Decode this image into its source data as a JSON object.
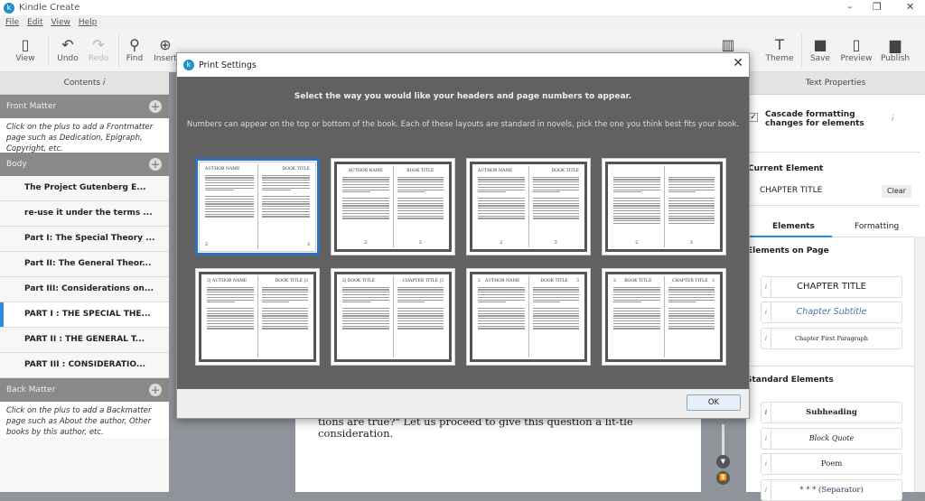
{
  "app": {
    "title": "Kindle Create",
    "window_controls": [
      "–",
      "❐",
      "✕"
    ]
  },
  "menu": [
    "File",
    "Edit",
    "View",
    "Help"
  ],
  "toolbar": {
    "left": [
      {
        "label": "View",
        "icon": "view-icon"
      },
      {
        "label": "Undo",
        "icon": "undo-icon"
      },
      {
        "label": "Redo",
        "icon": "redo-icon",
        "disabled": true
      },
      {
        "label": "Find",
        "icon": "search-icon"
      },
      {
        "label": "Insert",
        "icon": "plus-circle-icon"
      }
    ],
    "right": [
      {
        "label": "Theme",
        "icon": "theme-icon"
      },
      {
        "label": "Save",
        "icon": "save-icon"
      },
      {
        "label": "Preview",
        "icon": "tablet-icon"
      },
      {
        "label": "Publish",
        "icon": "box-icon"
      }
    ]
  },
  "contents": {
    "title": "Contents",
    "front_matter": {
      "label": "Front Matter",
      "hint": "Click on the plus to add a Frontmatter page such as Dedication, Epigraph, Copyright, etc."
    },
    "body": {
      "label": "Body",
      "items": [
        "The Project Gutenberg E...",
        "re-use it under the terms ...",
        "Part I: The Special Theory ...",
        "Part II: The General Theor...",
        "Part III: Considerations on...",
        "PART I : THE SPECIAL THE...",
        "PART II : THE GENERAL T...",
        "PART III : CONSIDERATIO..."
      ],
      "selected_index": 5
    },
    "back_matter": {
      "label": "Back Matter",
      "hint": "Click on the plus to add a Backmatter page such as About the author, Other books by this author, etc."
    }
  },
  "document": {
    "text": "tions are true?\" Let us proceed to give this question a lit-tle consideration."
  },
  "properties": {
    "title": "Text Properties",
    "cascade_label": "Cascade formatting changes for elements",
    "cascade_checked": true,
    "current_element_label": "Current Element",
    "current_element": "CHAPTER TITLE",
    "clear": "Clear",
    "tabs": [
      "Elements",
      "Formatting"
    ],
    "active_tab": "Elements",
    "elements_on_page_label": "Elements on Page",
    "elements_on_page": [
      "CHAPTER TITLE",
      "Chapter Subtitle",
      "Chapter First Paragraph"
    ],
    "standard_label": "Standard Elements",
    "standard": [
      "Subheading",
      "Block Quote",
      "Poem",
      "* * *  (Separator)"
    ]
  },
  "dialog": {
    "title": "Print Settings",
    "heading": "Select the way you would like your headers and page numbers to appear.",
    "subheading": "Numbers can appear on the top or bottom of the book. Each of these layouts are standard in novels, pick the one you think best fits your book.",
    "ok": "OK",
    "selected_index": 0,
    "layouts": [
      {
        "lh": [
          "AUTHOR NAME",
          ""
        ],
        "rh": [
          "",
          "BOOK TITLE"
        ],
        "lf": [
          "2",
          ""
        ],
        "rf": [
          "",
          "3"
        ],
        "align": "outer"
      },
      {
        "lh": [
          "AUTHOR NAME"
        ],
        "rh": [
          "BOOK TITLE"
        ],
        "lf": [
          "2"
        ],
        "rf": [
          "3"
        ],
        "align": "center"
      },
      {
        "lh": [
          "AUTHOR NAME",
          ""
        ],
        "rh": [
          "",
          "BOOK TITLE"
        ],
        "lf": [
          "2"
        ],
        "rf": [
          "3"
        ],
        "align": "mixed"
      },
      {
        "lh": [],
        "rh": [],
        "lf": [
          "2"
        ],
        "rf": [
          "3"
        ],
        "align": "center"
      },
      {
        "lh": [
          "2| AUTHOR NAME",
          ""
        ],
        "rh": [
          "",
          "BOOK TITLE |3"
        ],
        "lf": [],
        "rf": [],
        "align": "outer"
      },
      {
        "lh": [
          "2| BOOK TITLE",
          ""
        ],
        "rh": [
          "",
          "CHAPTER TITLE |3"
        ],
        "lf": [],
        "rf": [],
        "align": "outer"
      },
      {
        "lh": [
          "2",
          "AUTHOR NAME",
          ""
        ],
        "rh": [
          "",
          "BOOK TITLE",
          "3"
        ],
        "lf": [],
        "rf": [],
        "align": "spread"
      },
      {
        "lh": [
          "2",
          "BOOK TITLE",
          ""
        ],
        "rh": [
          "",
          "CHAPTER TITLE",
          "3"
        ],
        "lf": [],
        "rf": [],
        "align": "spread"
      }
    ]
  },
  "colors": {
    "accent": "#2b8de0",
    "section_header": "#8a8a8a",
    "dialog_bg": "#616161",
    "selected_border": "#2f6fc0"
  }
}
